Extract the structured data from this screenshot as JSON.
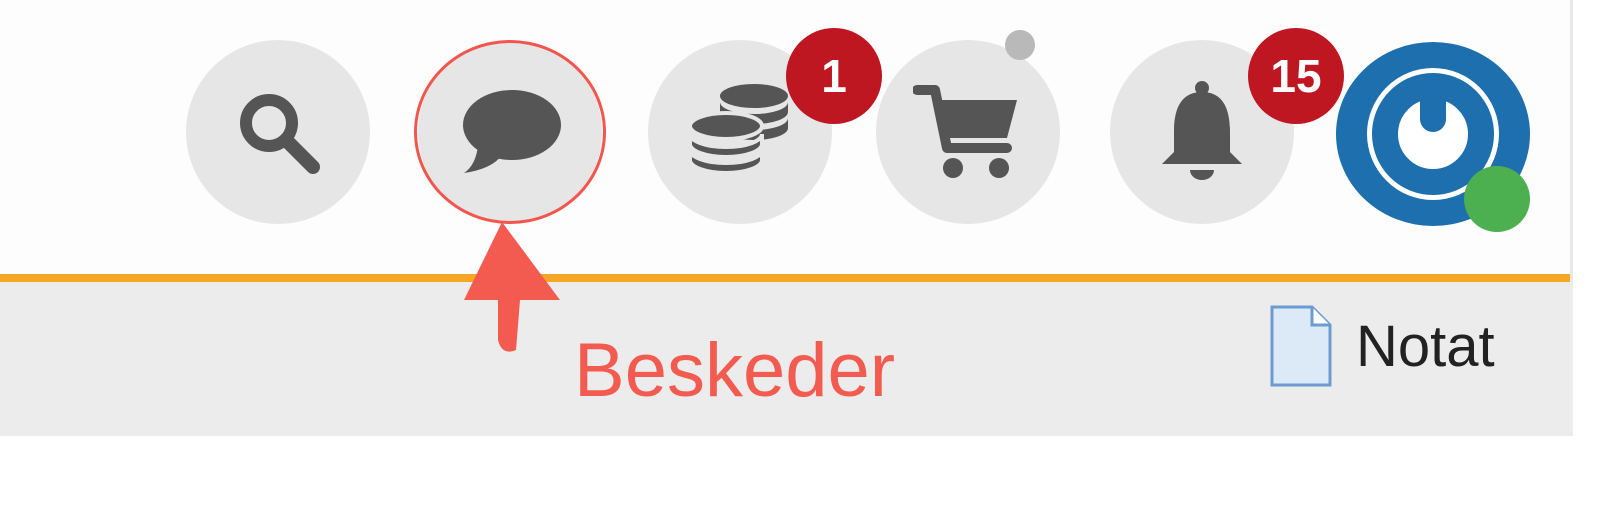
{
  "toolbar": {
    "icons": {
      "search": "search-icon",
      "messages": "speech-bubble-icon",
      "coins": "coins-icon",
      "cart": "shopping-cart-icon",
      "bell": "bell-icon",
      "avatar": "power-logo-icon",
      "note": "document-icon"
    },
    "coins_badge": "1",
    "notifications_badge": "15"
  },
  "annotation": {
    "label": "Beskeder"
  },
  "subbar": {
    "note_label": "Notat"
  },
  "colors": {
    "accent_border": "#f6a723",
    "badge": "#bf1722",
    "annotation": "#f35a50",
    "avatar_blue": "#1d6fae",
    "online_status": "#4caf50",
    "icon": "#555555",
    "button_bg": "#e6e6e6"
  }
}
